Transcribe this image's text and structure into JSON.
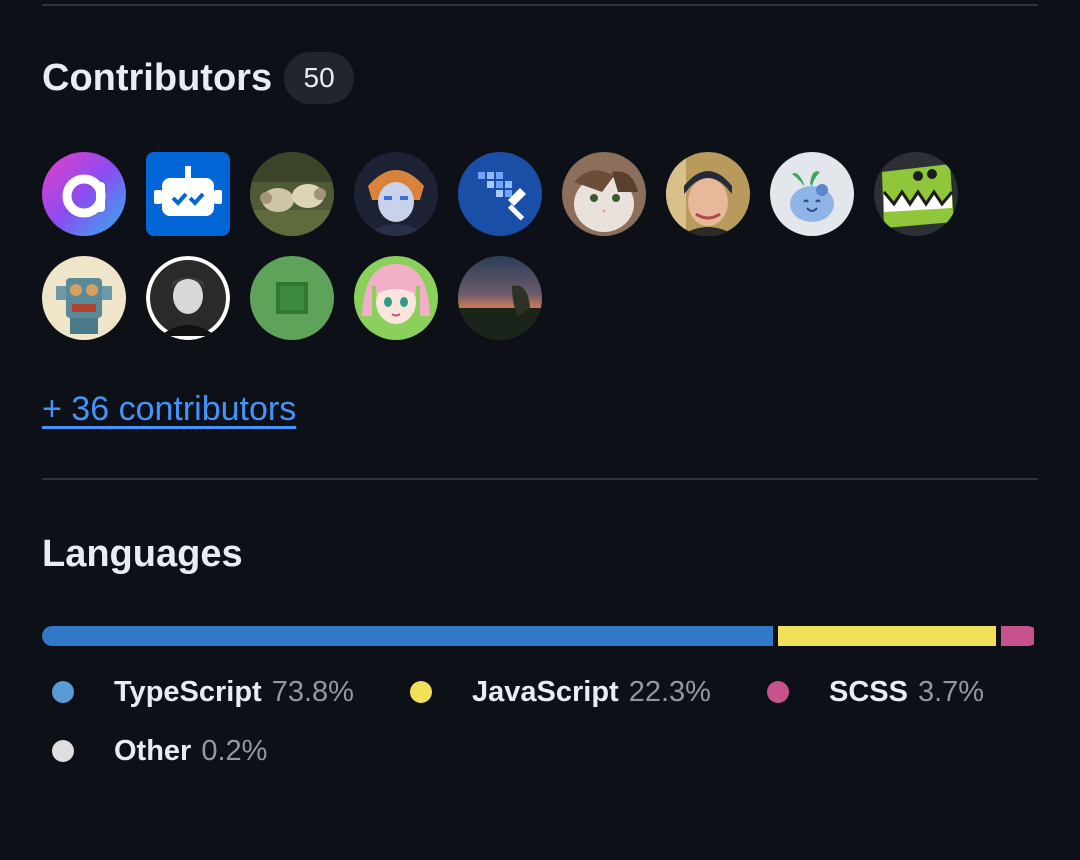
{
  "contributors": {
    "title": "Contributors",
    "count": "50",
    "more_link": "+ 36 contributors",
    "avatars": [
      {
        "name": "avatar-gradient-logo"
      },
      {
        "name": "avatar-bot"
      },
      {
        "name": "avatar-sheep"
      },
      {
        "name": "avatar-anime-boy"
      },
      {
        "name": "avatar-paint-roller"
      },
      {
        "name": "avatar-cat"
      },
      {
        "name": "avatar-man-beanie"
      },
      {
        "name": "avatar-blue-blob"
      },
      {
        "name": "avatar-green-monster"
      },
      {
        "name": "avatar-robot-toy"
      },
      {
        "name": "avatar-man-bw"
      },
      {
        "name": "avatar-green-square"
      },
      {
        "name": "avatar-anime-girl"
      },
      {
        "name": "avatar-sunset"
      }
    ]
  },
  "languages": {
    "title": "Languages",
    "items": [
      {
        "name": "TypeScript",
        "percent_label": "73.8%",
        "percent": 73.8,
        "color": "#3178c6",
        "dot_color": "#5a9ad6"
      },
      {
        "name": "JavaScript",
        "percent_label": "22.3%",
        "percent": 22.3,
        "color": "#f1e05a",
        "dot_color": "#f1e05a"
      },
      {
        "name": "SCSS",
        "percent_label": "3.7%",
        "percent": 3.7,
        "color": "#c6538c",
        "dot_color": "#c6538c"
      },
      {
        "name": "Other",
        "percent_label": "0.2%",
        "percent": 0.2,
        "color": "#ededed",
        "dot_color": "#dedede"
      }
    ]
  }
}
